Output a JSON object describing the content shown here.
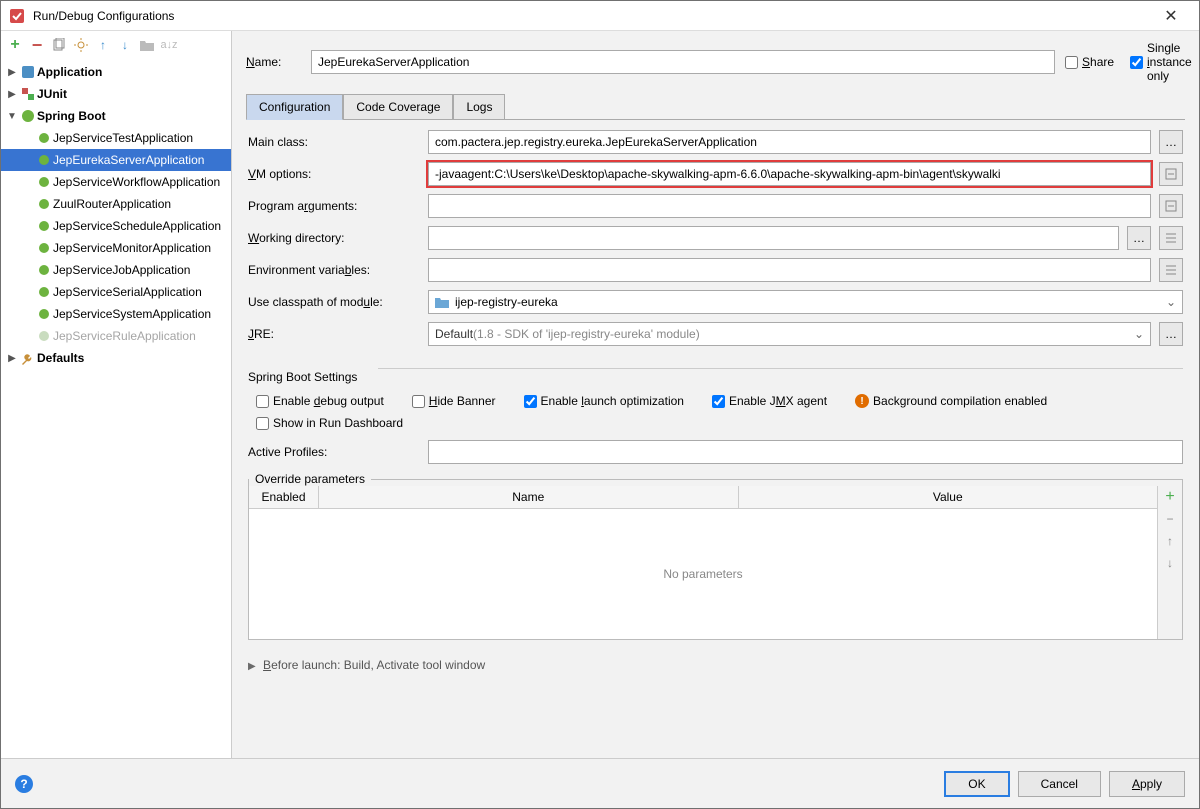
{
  "window": {
    "title": "Run/Debug Configurations"
  },
  "toolbar": {
    "add": "+",
    "remove": "−"
  },
  "tree": {
    "application": "Application",
    "junit": "JUnit",
    "springboot": "Spring Boot",
    "defaults": "Defaults",
    "children": [
      "JepServiceTestApplication",
      "JepEurekaServerApplication",
      "JepServiceWorkflowApplication",
      "ZuulRouterApplication",
      "JepServiceScheduleApplication",
      "JepServiceMonitorApplication",
      "JepServiceJobApplication",
      "JepServiceSerialApplication",
      "JepServiceSystemApplication",
      "JepServiceRuleApplication"
    ]
  },
  "form": {
    "name_label": "Name:",
    "name_value": "JepEurekaServerApplication",
    "share_label": "Share",
    "single_instance_label": "Single instance only",
    "tabs": {
      "configuration": "Configuration",
      "coverage": "Code Coverage",
      "logs": "Logs"
    },
    "main_class_label": "Main class:",
    "main_class_value": "com.pactera.jep.registry.eureka.JepEurekaServerApplication",
    "vm_options_label": "VM options:",
    "vm_options_value": "-javaagent:C:\\Users\\ke\\Desktop\\apache-skywalking-apm-6.6.0\\apache-skywalking-apm-bin\\agent\\skywalki",
    "program_args_label": "Program arguments:",
    "working_dir_label": "Working directory:",
    "env_vars_label": "Environment variables:",
    "ucom_label": "Use classpath of module:",
    "ucom_value": "ijep-registry-eureka",
    "jre_label": "JRE:",
    "jre_value_pre": "Default ",
    "jre_value_muted": "(1.8 - SDK of 'ijep-registry-eureka' module)",
    "spring_settings_label": "Spring Boot Settings",
    "enable_debug": "Enable debug output",
    "hide_banner": "Hide Banner",
    "enable_launch_opt": "Enable launch optimization",
    "enable_jmx": "Enable JMX agent",
    "bgc": "Background compilation enabled",
    "show_dashboard": "Show in Run Dashboard",
    "active_profiles_label": "Active Profiles:",
    "override_legend": "Override parameters",
    "col_enabled": "Enabled",
    "col_name": "Name",
    "col_value": "Value",
    "no_params": "No parameters",
    "before_launch": "Before launch: Build, Activate tool window"
  },
  "buttons": {
    "ok": "OK",
    "cancel": "Cancel",
    "apply": "Apply"
  }
}
